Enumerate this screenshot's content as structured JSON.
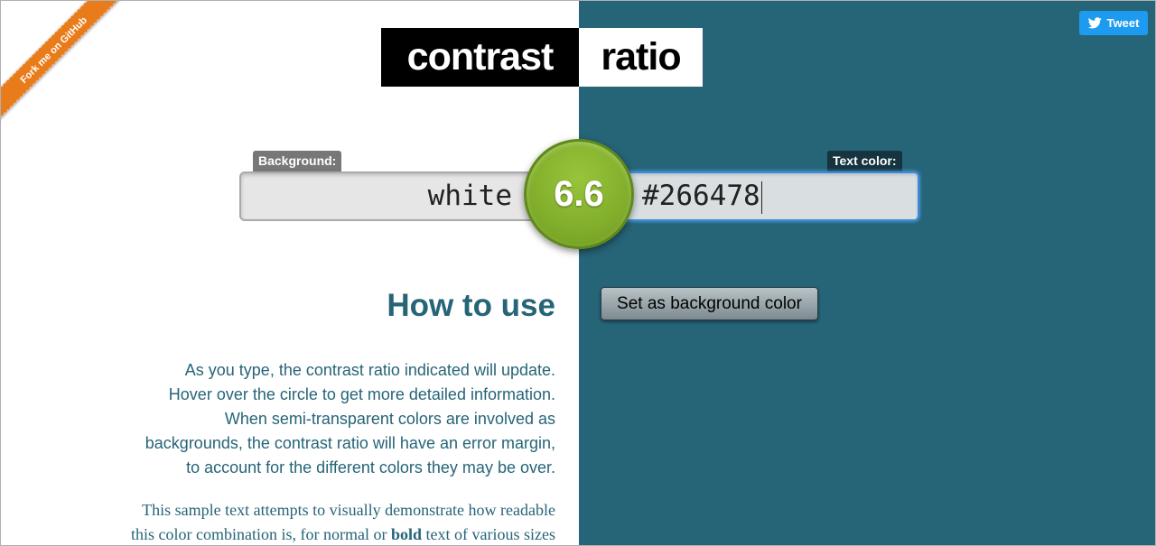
{
  "ribbon": {
    "label": "Fork me on GitHub"
  },
  "tweet": {
    "label": "Tweet",
    "icon": "twitter-bird-icon"
  },
  "logo": {
    "left": "contrast",
    "right": "ratio"
  },
  "background": {
    "label": "Background:",
    "value": "white"
  },
  "text_color": {
    "label": "Text color:",
    "value": "#266478"
  },
  "ratio": {
    "value": "6.6"
  },
  "set_bg_button": {
    "label": "Set as background color"
  },
  "how_to_use": {
    "title": "How to use",
    "lines": [
      "As you type, the contrast ratio indicated will update.",
      "Hover over the circle to get more detailed information.",
      "When semi-transparent colors are involved as",
      "backgrounds, the contrast ratio will have an error margin,",
      "to account for the different colors they may be over."
    ]
  },
  "sample": {
    "line1": "This sample text attempts to visually demonstrate how readable",
    "line2_a": "this color combination is, for normal or ",
    "line2_bold": "bold",
    "line2_b": " text of various sizes"
  },
  "colors": {
    "accent": "#266478",
    "ratio_good": "#83b02c",
    "ribbon": "#e97b1a",
    "tweet": "#1d9bf0"
  }
}
